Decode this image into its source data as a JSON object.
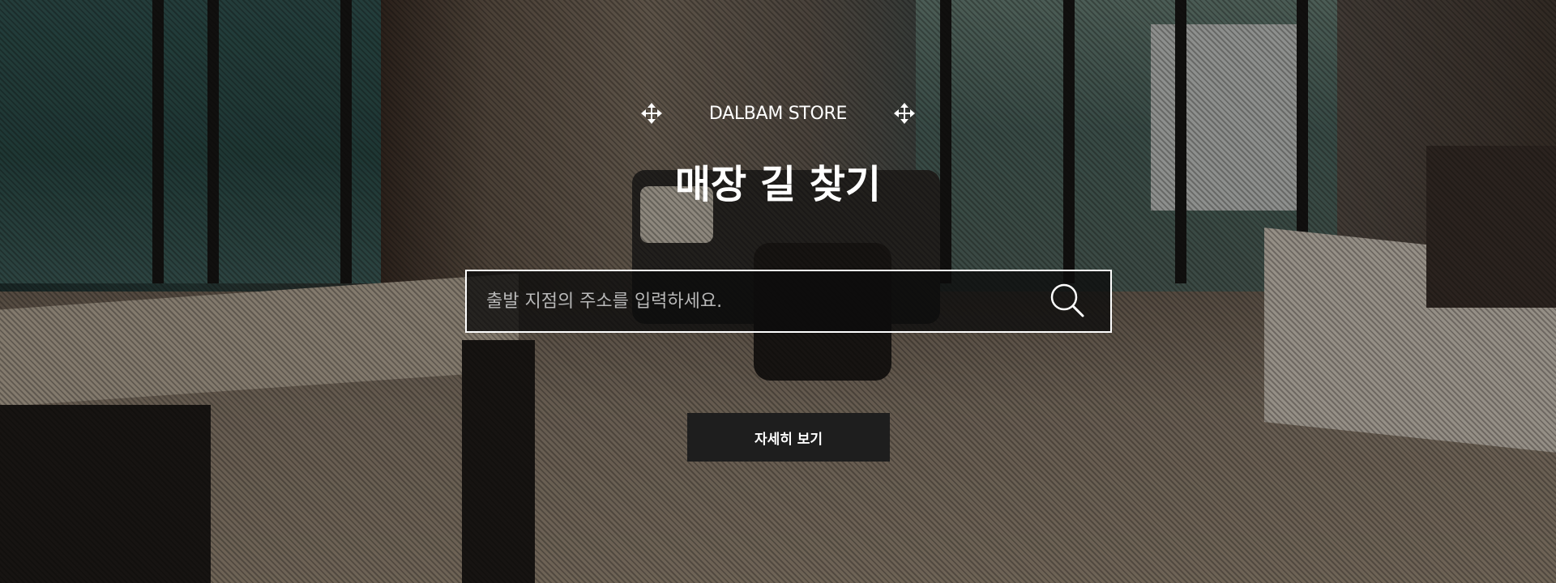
{
  "brand": {
    "name": "DALBAM STORE",
    "left_icon": "move-arrows-icon",
    "right_icon": "move-arrows-icon"
  },
  "title": "매장 길 찾기",
  "search": {
    "placeholder": "출발 지점의 주소를 입력하세요.",
    "value": "",
    "icon": "search-icon"
  },
  "detail_button": {
    "label": "자세히 보기"
  },
  "colors": {
    "text": "#ffffff",
    "search_border": "#ffffff",
    "button_bg": "#1e1e1e"
  }
}
